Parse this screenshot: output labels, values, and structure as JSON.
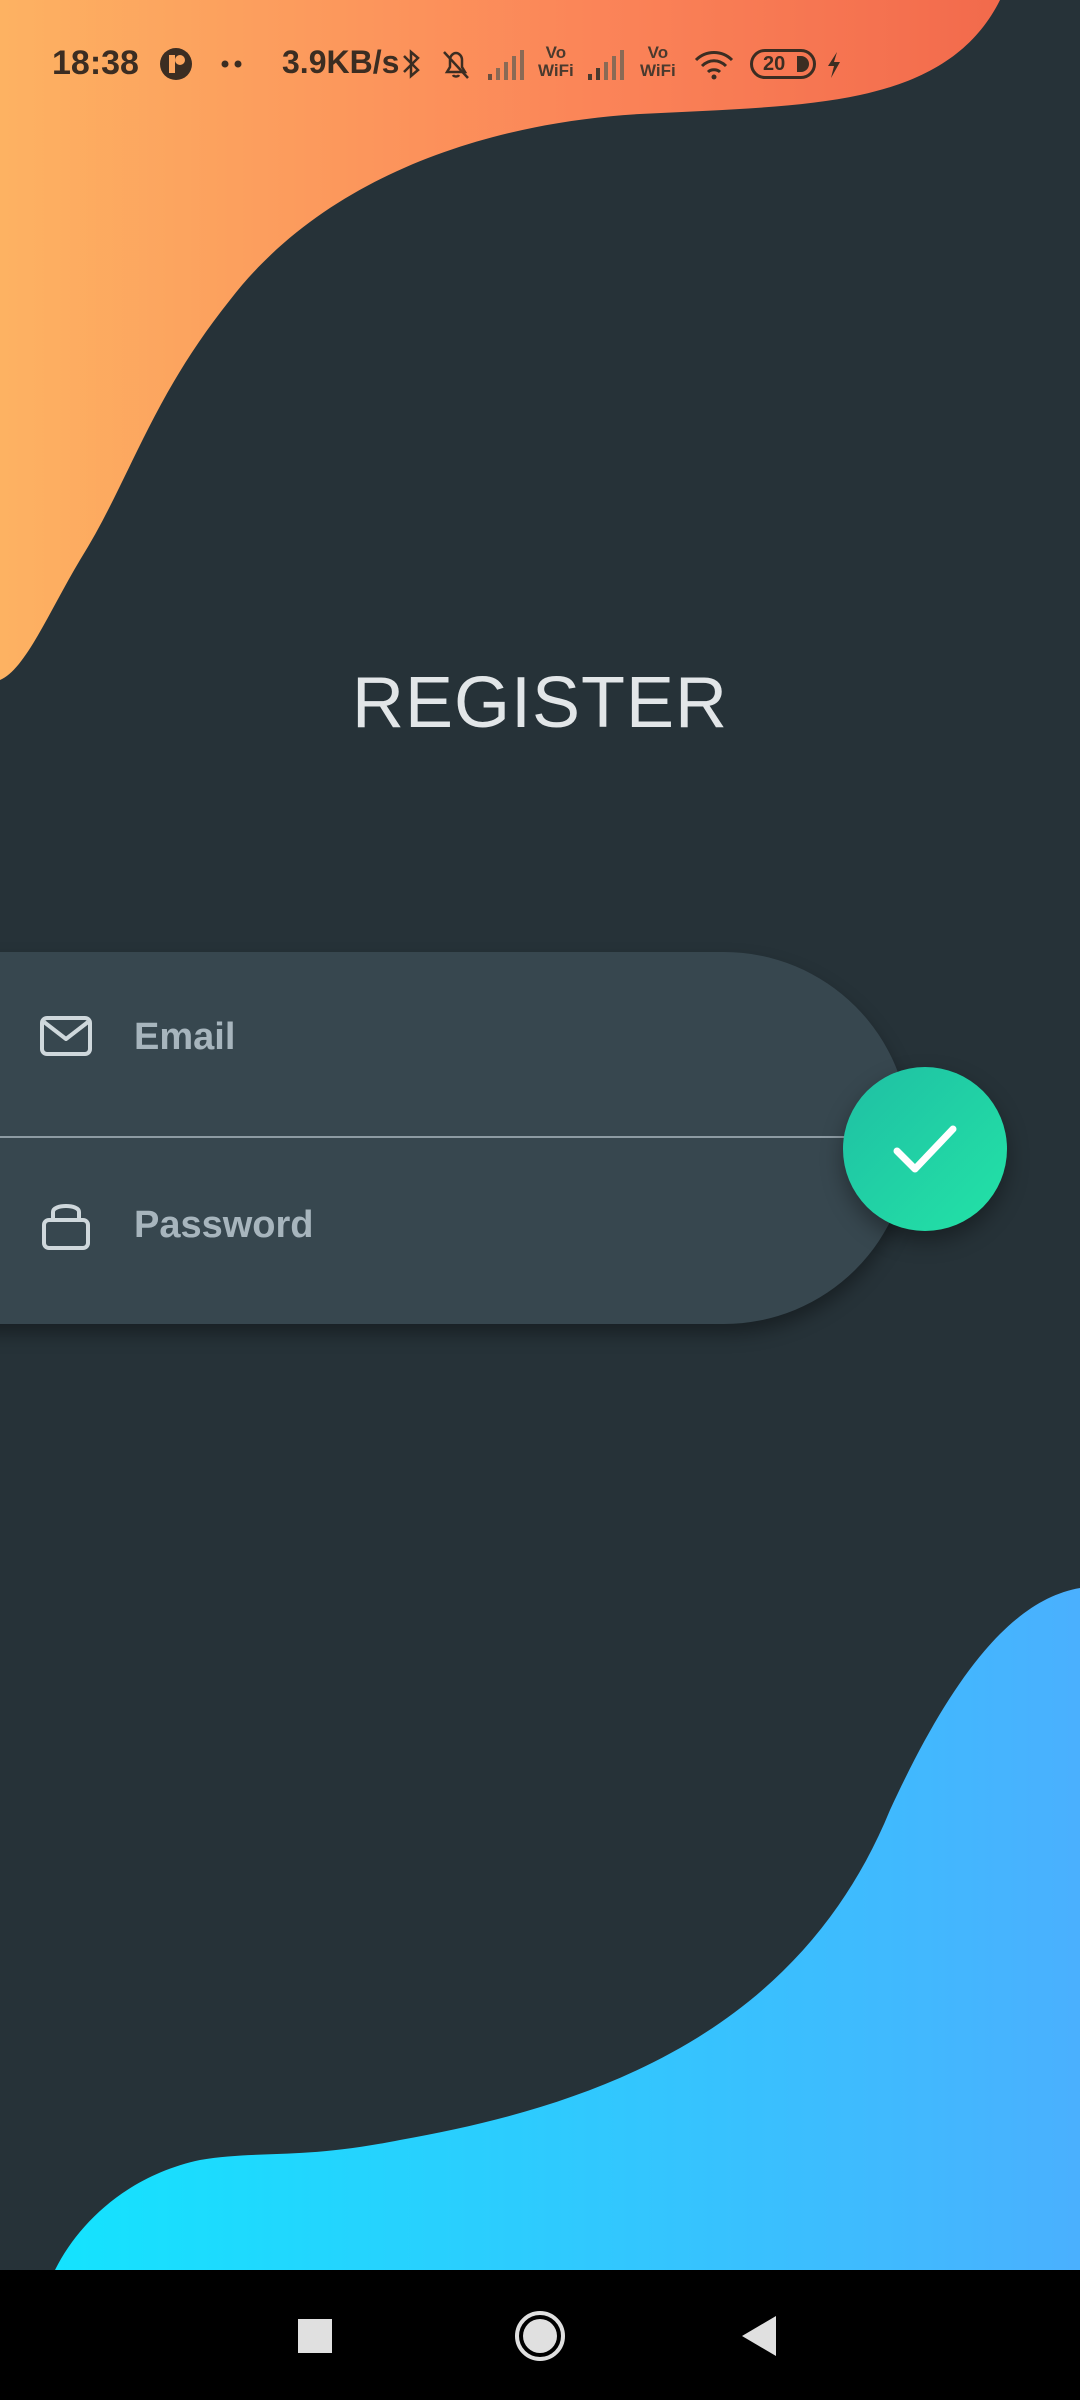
{
  "status_bar": {
    "time": "18:38",
    "net_speed": "3.9KB/s",
    "vowifi_1": [
      "Vo",
      "WiFi"
    ],
    "vowifi_2": [
      "Vo",
      "WiFi"
    ],
    "battery_level": "20",
    "icons": [
      "app-notification-icon",
      "more-dots-icon",
      "bluetooth-icon",
      "bell-muted-icon",
      "signal-icon",
      "wifi-icon",
      "charging-icon"
    ]
  },
  "register": {
    "title": "REGISTER",
    "email": {
      "value": "",
      "placeholder": "Email",
      "icon": "mail-icon"
    },
    "password": {
      "value": "",
      "placeholder": "Password",
      "icon": "lock-icon"
    },
    "submit_icon": "check-icon"
  },
  "nav_bar": {
    "icons": [
      "recents-square-icon",
      "home-circle-icon",
      "back-triangle-icon"
    ]
  },
  "colors": {
    "background": "#263238",
    "card": "#37474f",
    "accent_green": "#1ed8a6",
    "orange_gradient": [
      "#fcb460",
      "#fa7c52"
    ],
    "blue_gradient": [
      "#14e3fe",
      "#4bb0fe"
    ]
  }
}
